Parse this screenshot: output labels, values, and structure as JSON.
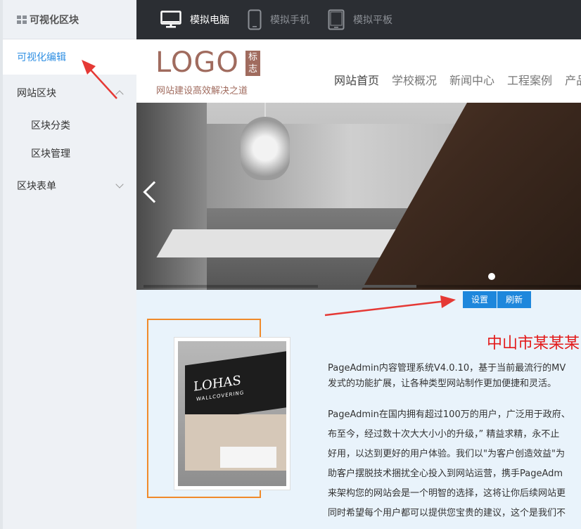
{
  "sidebar": {
    "title": "可视化区块",
    "active_item": "可视化编辑",
    "items": [
      {
        "label": "网站区块"
      },
      {
        "label": "区块分类"
      },
      {
        "label": "区块管理"
      },
      {
        "label": "区块表单"
      }
    ]
  },
  "devicebar": {
    "devices": [
      {
        "label": "模拟电脑",
        "icon": "monitor-icon"
      },
      {
        "label": "模拟手机",
        "icon": "phone-icon"
      },
      {
        "label": "模拟平板",
        "icon": "tablet-icon"
      }
    ]
  },
  "site": {
    "logo": "LOGO",
    "logo_badge": "标志",
    "slogan": "网站建设高效解决之道",
    "nav": [
      "网站首页",
      "学校概况",
      "新闻中心",
      "工程案例",
      "产品"
    ]
  },
  "banner": {
    "booth_brand": "LOHAS",
    "booth_sub": "WALLCOVERING"
  },
  "content": {
    "buttons": [
      "设置",
      "刷新"
    ],
    "title": "中山市某某某",
    "paragraphs": [
      "PageAdmin内容管理系统V4.0.10，基于当前最流行的MV",
      "发式的功能扩展，让各种类型网站制作更加便捷和灵活。",
      "PageAdmin在国内拥有超过100万的用户，广泛用于政府、",
      "布至今，经过数十次大大小小的升级，” 精益求精，永不止",
      "好用，以达到更好的用户体验。我们以\"为客户创造效益\"为",
      "助客户摆脱技术捆扰全心投入到网站运营，携手PageAdm",
      "来架构您的网站会是一个明智的选择，这将让你后续网站更",
      "同时希望每个用户都可以提供您宝贵的建议，这个是我们不"
    ]
  },
  "colors": {
    "accent_blue": "#1e87dc",
    "logo_brown": "#a06b5e",
    "title_red": "#e31a1a",
    "arrow_red": "#e53935"
  }
}
